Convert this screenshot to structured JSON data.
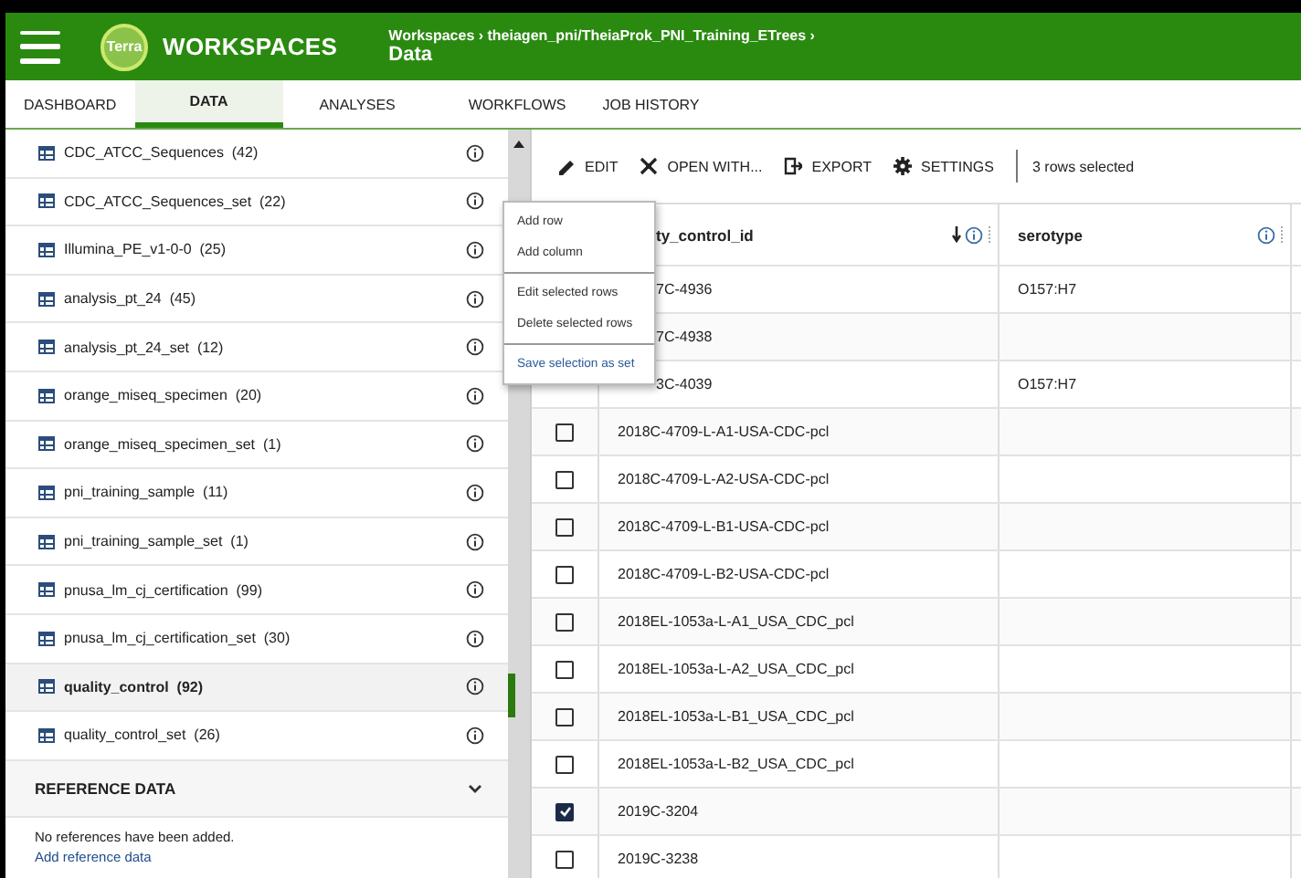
{
  "header": {
    "app_title": "WORKSPACES",
    "logo_text": "Terra",
    "breadcrumb": "Workspaces › theiagen_pni/TheiaProk_PNI_Training_ETrees ›",
    "page_title": "Data"
  },
  "tabs": [
    {
      "label": "DASHBOARD",
      "selected": false
    },
    {
      "label": "DATA",
      "selected": true
    },
    {
      "label": "ANALYSES",
      "selected": false
    },
    {
      "label": "WORKFLOWS",
      "selected": false
    },
    {
      "label": "JOB HISTORY",
      "selected": false
    }
  ],
  "sidebar": {
    "tables": [
      {
        "label": "CDC_ATCC_Sequences",
        "count": "(42)",
        "selected": false
      },
      {
        "label": "CDC_ATCC_Sequences_set",
        "count": "(22)",
        "selected": false
      },
      {
        "label": "Illumina_PE_v1-0-0",
        "count": "(25)",
        "selected": false
      },
      {
        "label": "analysis_pt_24",
        "count": "(45)",
        "selected": false
      },
      {
        "label": "analysis_pt_24_set",
        "count": "(12)",
        "selected": false
      },
      {
        "label": "orange_miseq_specimen",
        "count": "(20)",
        "selected": false
      },
      {
        "label": "orange_miseq_specimen_set",
        "count": "(1)",
        "selected": false
      },
      {
        "label": "pni_training_sample",
        "count": "(11)",
        "selected": false
      },
      {
        "label": "pni_training_sample_set",
        "count": "(1)",
        "selected": false
      },
      {
        "label": "pnusa_lm_cj_certification",
        "count": "(99)",
        "selected": false
      },
      {
        "label": "pnusa_lm_cj_certification_set",
        "count": "(30)",
        "selected": false
      },
      {
        "label": "quality_control",
        "count": "(92)",
        "selected": true
      },
      {
        "label": "quality_control_set",
        "count": "(26)",
        "selected": false
      }
    ],
    "reference": {
      "title": "REFERENCE DATA",
      "expanded": false,
      "message": "No references have been added.",
      "link": "Add reference data"
    }
  },
  "toolbar": {
    "buttons": [
      {
        "label": "EDIT",
        "kind": "edit"
      },
      {
        "label": "OPEN WITH...",
        "kind": "open"
      },
      {
        "label": "EXPORT",
        "kind": "export"
      },
      {
        "label": "SETTINGS",
        "kind": "settings"
      }
    ],
    "selection": "3 rows selected"
  },
  "table": {
    "columns": [
      "ty_control_id",
      "serotype"
    ],
    "rows": [
      {
        "id": "7C-4936",
        "serotype": "O157:H7"
      },
      {
        "id": "7C-4938"
      },
      {
        "id": "3C-4039",
        "serotype": "O157:H7"
      },
      {
        "id": "2018C-4709-L-A1-USA-CDC-pcl",
        "checked": false
      },
      {
        "id": "2018C-4709-L-A2-USA-CDC-pcl",
        "checked": false
      },
      {
        "id": "2018C-4709-L-B1-USA-CDC-pcl",
        "checked": false
      },
      {
        "id": "2018C-4709-L-B2-USA-CDC-pcl",
        "checked": false
      },
      {
        "id": "2018EL-1053a-L-A1_USA_CDC_pcl",
        "checked": false
      },
      {
        "id": "2018EL-1053a-L-A2_USA_CDC_pcl",
        "checked": false
      },
      {
        "id": "2018EL-1053a-L-B1_USA_CDC_pcl",
        "checked": false
      },
      {
        "id": "2018EL-1053a-L-B2_USA_CDC_pcl",
        "checked": false
      },
      {
        "id": "2019C-3204",
        "checked": true
      },
      {
        "id": "2019C-3238",
        "checked": false
      }
    ]
  },
  "edit_menu": {
    "groups": [
      [
        "Add row",
        "Add column"
      ],
      [
        "Edit selected rows",
        "Delete selected rows"
      ],
      [
        "Save selection as set"
      ]
    ]
  }
}
